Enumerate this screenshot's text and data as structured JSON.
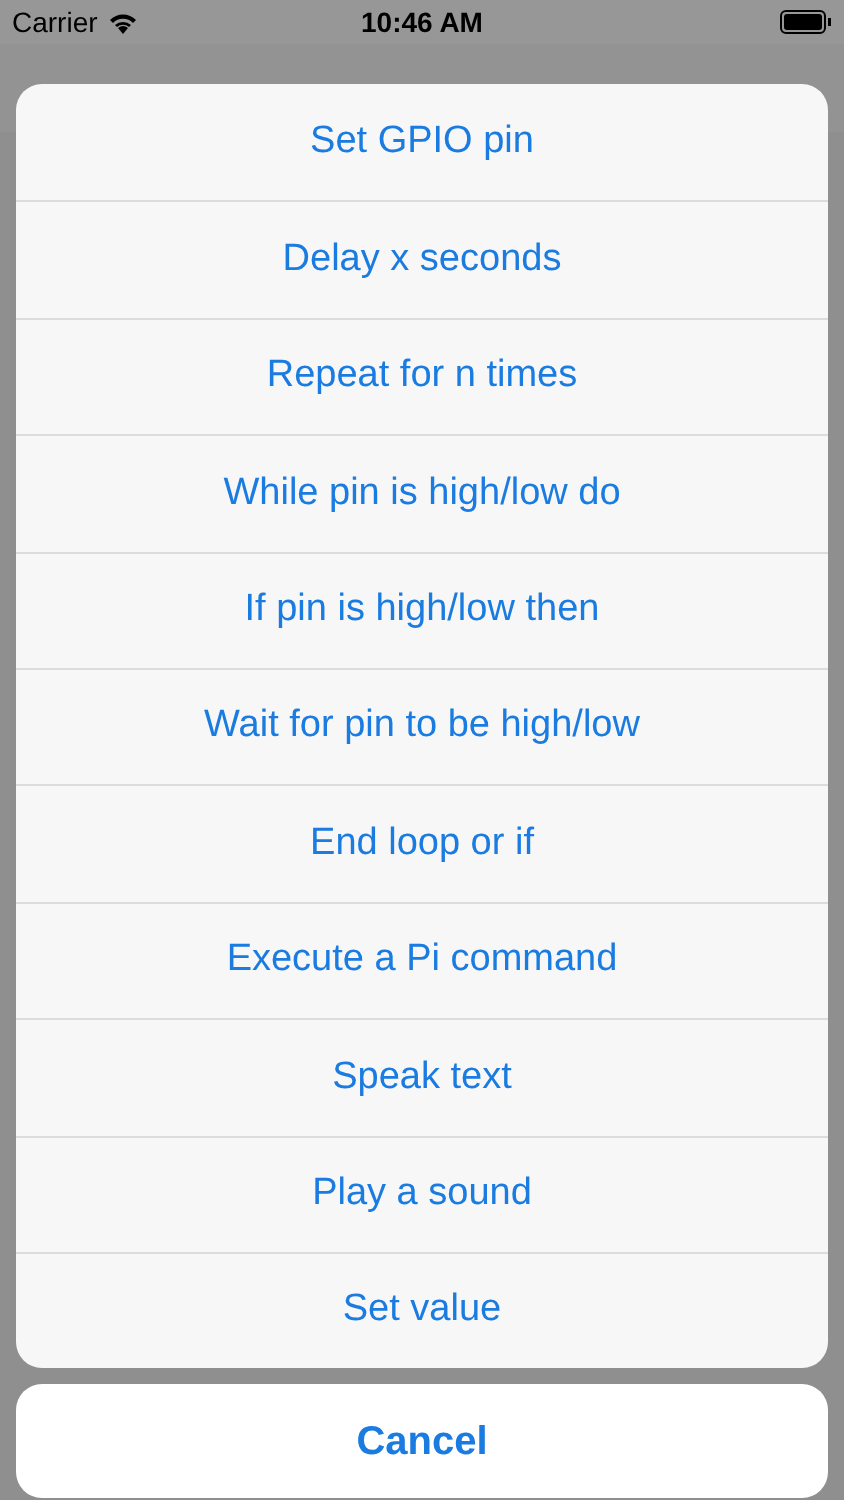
{
  "status_bar": {
    "carrier": "Carrier",
    "time": "10:46 AM"
  },
  "action_sheet": {
    "actions": [
      {
        "label": "Set GPIO pin"
      },
      {
        "label": "Delay x seconds"
      },
      {
        "label": "Repeat for n times"
      },
      {
        "label": "While pin is high/low do"
      },
      {
        "label": "If pin is high/low then"
      },
      {
        "label": "Wait for pin to be high/low"
      },
      {
        "label": "End loop or if"
      },
      {
        "label": "Execute a Pi command"
      },
      {
        "label": "Speak text"
      },
      {
        "label": "Play a sound"
      },
      {
        "label": "Set value"
      }
    ],
    "cancel": "Cancel"
  }
}
